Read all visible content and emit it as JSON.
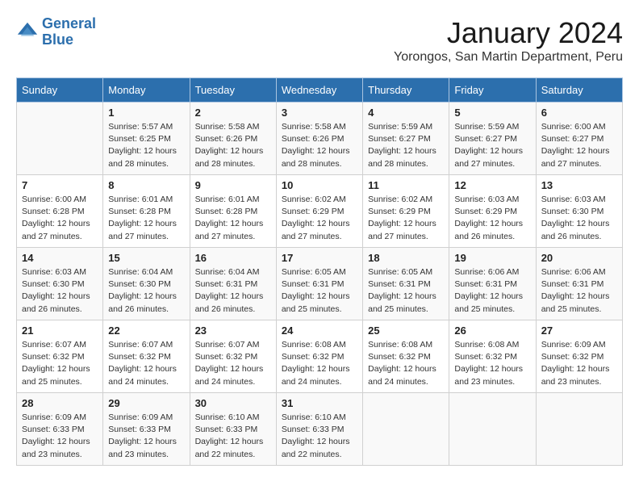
{
  "header": {
    "logo_line1": "General",
    "logo_line2": "Blue",
    "month": "January 2024",
    "location": "Yorongos, San Martin Department, Peru"
  },
  "weekdays": [
    "Sunday",
    "Monday",
    "Tuesday",
    "Wednesday",
    "Thursday",
    "Friday",
    "Saturday"
  ],
  "weeks": [
    [
      {
        "day": "",
        "info": ""
      },
      {
        "day": "1",
        "info": "Sunrise: 5:57 AM\nSunset: 6:25 PM\nDaylight: 12 hours\nand 28 minutes."
      },
      {
        "day": "2",
        "info": "Sunrise: 5:58 AM\nSunset: 6:26 PM\nDaylight: 12 hours\nand 28 minutes."
      },
      {
        "day": "3",
        "info": "Sunrise: 5:58 AM\nSunset: 6:26 PM\nDaylight: 12 hours\nand 28 minutes."
      },
      {
        "day": "4",
        "info": "Sunrise: 5:59 AM\nSunset: 6:27 PM\nDaylight: 12 hours\nand 28 minutes."
      },
      {
        "day": "5",
        "info": "Sunrise: 5:59 AM\nSunset: 6:27 PM\nDaylight: 12 hours\nand 27 minutes."
      },
      {
        "day": "6",
        "info": "Sunrise: 6:00 AM\nSunset: 6:27 PM\nDaylight: 12 hours\nand 27 minutes."
      }
    ],
    [
      {
        "day": "7",
        "info": "Sunrise: 6:00 AM\nSunset: 6:28 PM\nDaylight: 12 hours\nand 27 minutes."
      },
      {
        "day": "8",
        "info": "Sunrise: 6:01 AM\nSunset: 6:28 PM\nDaylight: 12 hours\nand 27 minutes."
      },
      {
        "day": "9",
        "info": "Sunrise: 6:01 AM\nSunset: 6:28 PM\nDaylight: 12 hours\nand 27 minutes."
      },
      {
        "day": "10",
        "info": "Sunrise: 6:02 AM\nSunset: 6:29 PM\nDaylight: 12 hours\nand 27 minutes."
      },
      {
        "day": "11",
        "info": "Sunrise: 6:02 AM\nSunset: 6:29 PM\nDaylight: 12 hours\nand 27 minutes."
      },
      {
        "day": "12",
        "info": "Sunrise: 6:03 AM\nSunset: 6:29 PM\nDaylight: 12 hours\nand 26 minutes."
      },
      {
        "day": "13",
        "info": "Sunrise: 6:03 AM\nSunset: 6:30 PM\nDaylight: 12 hours\nand 26 minutes."
      }
    ],
    [
      {
        "day": "14",
        "info": "Sunrise: 6:03 AM\nSunset: 6:30 PM\nDaylight: 12 hours\nand 26 minutes."
      },
      {
        "day": "15",
        "info": "Sunrise: 6:04 AM\nSunset: 6:30 PM\nDaylight: 12 hours\nand 26 minutes."
      },
      {
        "day": "16",
        "info": "Sunrise: 6:04 AM\nSunset: 6:31 PM\nDaylight: 12 hours\nand 26 minutes."
      },
      {
        "day": "17",
        "info": "Sunrise: 6:05 AM\nSunset: 6:31 PM\nDaylight: 12 hours\nand 25 minutes."
      },
      {
        "day": "18",
        "info": "Sunrise: 6:05 AM\nSunset: 6:31 PM\nDaylight: 12 hours\nand 25 minutes."
      },
      {
        "day": "19",
        "info": "Sunrise: 6:06 AM\nSunset: 6:31 PM\nDaylight: 12 hours\nand 25 minutes."
      },
      {
        "day": "20",
        "info": "Sunrise: 6:06 AM\nSunset: 6:31 PM\nDaylight: 12 hours\nand 25 minutes."
      }
    ],
    [
      {
        "day": "21",
        "info": "Sunrise: 6:07 AM\nSunset: 6:32 PM\nDaylight: 12 hours\nand 25 minutes."
      },
      {
        "day": "22",
        "info": "Sunrise: 6:07 AM\nSunset: 6:32 PM\nDaylight: 12 hours\nand 24 minutes."
      },
      {
        "day": "23",
        "info": "Sunrise: 6:07 AM\nSunset: 6:32 PM\nDaylight: 12 hours\nand 24 minutes."
      },
      {
        "day": "24",
        "info": "Sunrise: 6:08 AM\nSunset: 6:32 PM\nDaylight: 12 hours\nand 24 minutes."
      },
      {
        "day": "25",
        "info": "Sunrise: 6:08 AM\nSunset: 6:32 PM\nDaylight: 12 hours\nand 24 minutes."
      },
      {
        "day": "26",
        "info": "Sunrise: 6:08 AM\nSunset: 6:32 PM\nDaylight: 12 hours\nand 23 minutes."
      },
      {
        "day": "27",
        "info": "Sunrise: 6:09 AM\nSunset: 6:32 PM\nDaylight: 12 hours\nand 23 minutes."
      }
    ],
    [
      {
        "day": "28",
        "info": "Sunrise: 6:09 AM\nSunset: 6:33 PM\nDaylight: 12 hours\nand 23 minutes."
      },
      {
        "day": "29",
        "info": "Sunrise: 6:09 AM\nSunset: 6:33 PM\nDaylight: 12 hours\nand 23 minutes."
      },
      {
        "day": "30",
        "info": "Sunrise: 6:10 AM\nSunset: 6:33 PM\nDaylight: 12 hours\nand 22 minutes."
      },
      {
        "day": "31",
        "info": "Sunrise: 6:10 AM\nSunset: 6:33 PM\nDaylight: 12 hours\nand 22 minutes."
      },
      {
        "day": "",
        "info": ""
      },
      {
        "day": "",
        "info": ""
      },
      {
        "day": "",
        "info": ""
      }
    ]
  ]
}
